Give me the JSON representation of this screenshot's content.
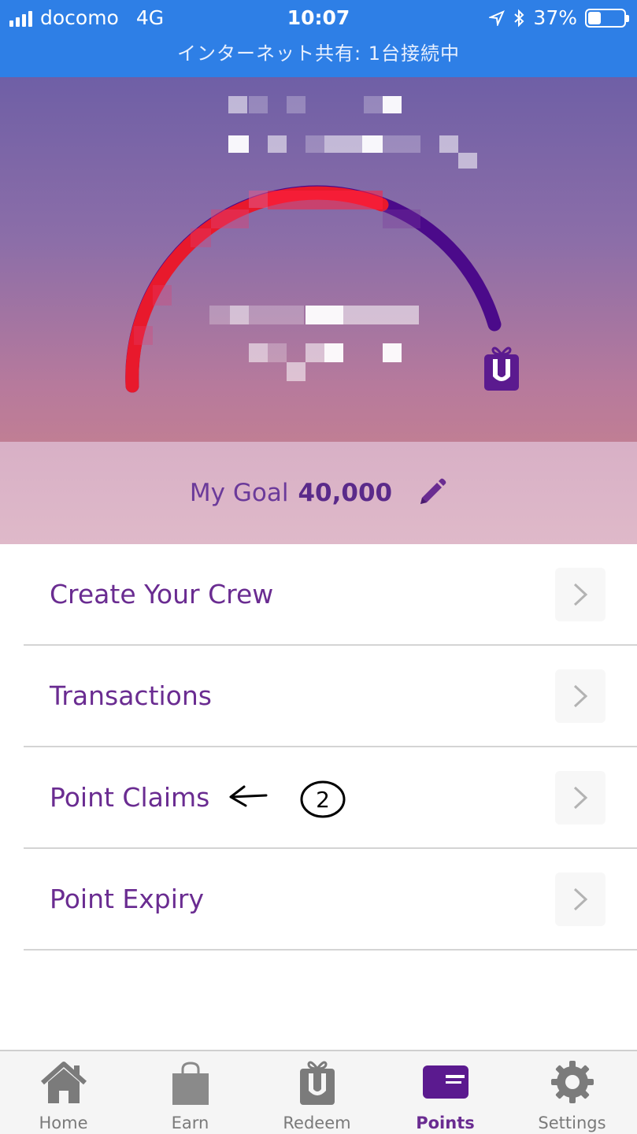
{
  "status_bar": {
    "carrier": "docomo",
    "network": "4G",
    "time": "10:07",
    "battery_percent": "37%",
    "battery_level": 0.37,
    "tethering_text": "インターネット共有: 1台接続中"
  },
  "hero": {
    "balance_label_obscured": "Points Balance",
    "logo_letter": "U",
    "gauge_progress_fraction": 0.55,
    "colors": {
      "progress": "#e8192c",
      "track": "#4b0a8a"
    }
  },
  "goal": {
    "label": "My Goal",
    "value": "40,000"
  },
  "menu": {
    "items": [
      {
        "label": "Create Your Crew"
      },
      {
        "label": "Transactions"
      },
      {
        "label": "Point Claims"
      },
      {
        "label": "Point Expiry"
      }
    ],
    "annotation": "②"
  },
  "tabs": [
    {
      "label": "Home",
      "icon": "home-icon"
    },
    {
      "label": "Earn",
      "icon": "shopping-bag-icon"
    },
    {
      "label": "Redeem",
      "icon": "gift-u-icon"
    },
    {
      "label": "Points",
      "icon": "card-icon",
      "active": true
    },
    {
      "label": "Settings",
      "icon": "gear-icon"
    }
  ],
  "colors": {
    "brand_purple": "#6a2c91",
    "status_bar": "#2e7fe6"
  }
}
